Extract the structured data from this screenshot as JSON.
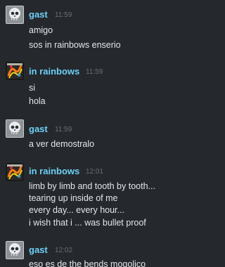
{
  "messages": [
    {
      "sender": "gast",
      "time": "11:59",
      "avatar": "skull-avatar-icon",
      "lines": [
        "amigo",
        "sos in rainbows enserio"
      ]
    },
    {
      "sender": "in rainbows",
      "time": "11:59",
      "avatar": "album-art-avatar-icon",
      "lines": [
        "si",
        "hola"
      ]
    },
    {
      "sender": "gast",
      "time": "11:59",
      "avatar": "skull-avatar-icon",
      "lines": [
        "a ver demostralo"
      ]
    },
    {
      "sender": "in rainbows",
      "time": "12:01",
      "avatar": "album-art-avatar-icon",
      "lines": [
        "limb by limb and tooth by tooth...",
        "tearing up inside of me",
        "every day... every hour...",
        "i wish that i ... was bullet proof"
      ]
    },
    {
      "sender": "gast",
      "time": "12:02",
      "avatar": "skull-avatar-icon",
      "lines": [
        "eso es de the bends mogolico"
      ]
    }
  ],
  "colors": {
    "background": "#25292e",
    "sender_name": "#6dcff6",
    "timestamp": "#6a6f75",
    "message_text": "#e4e6e8"
  }
}
